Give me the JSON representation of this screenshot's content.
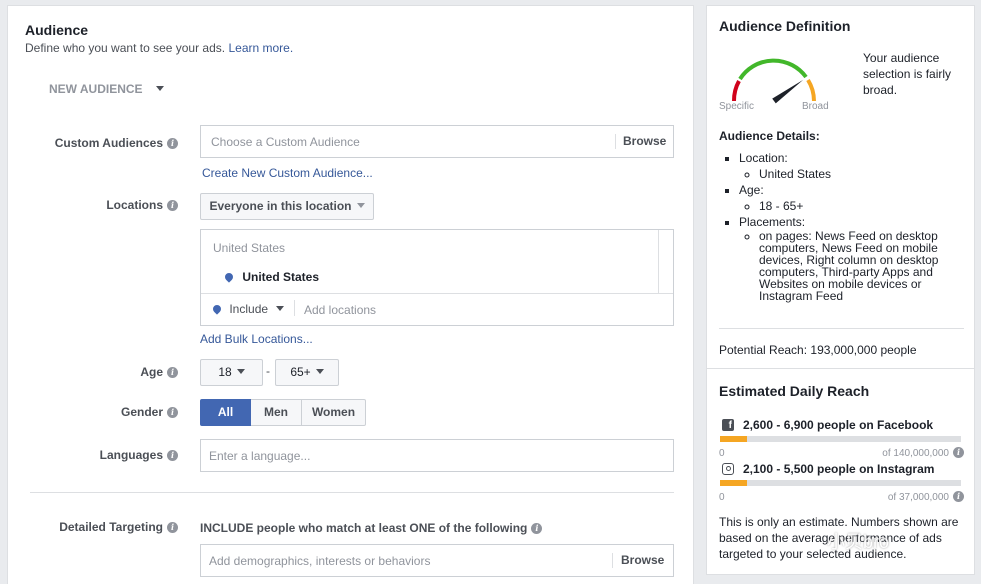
{
  "audience": {
    "title": "Audience",
    "subtitle": "Define who you want to see your ads.",
    "learn_more": "Learn more.",
    "new_audience": "NEW AUDIENCE"
  },
  "custom_audiences": {
    "label": "Custom Audiences",
    "placeholder": "Choose a Custom Audience",
    "browse": "Browse",
    "create_link": "Create New Custom Audience..."
  },
  "locations": {
    "label": "Locations",
    "dropdown": "Everyone in this location",
    "group_header": "United States",
    "selected": "United States",
    "include": "Include",
    "add_placeholder": "Add locations",
    "bulk_link": "Add Bulk Locations..."
  },
  "age": {
    "label": "Age",
    "min": "18",
    "dash": "-",
    "max": "65+"
  },
  "gender": {
    "label": "Gender",
    "options": [
      "All",
      "Men",
      "Women"
    ],
    "selected": "All"
  },
  "languages": {
    "label": "Languages",
    "placeholder": "Enter a language..."
  },
  "detailed": {
    "label": "Detailed Targeting",
    "include_text": "INCLUDE people who match at least ONE of the following",
    "placeholder": "Add demographics, interests or behaviors",
    "browse": "Browse"
  },
  "definition": {
    "title": "Audience Definition",
    "gauge_specific": "Specific",
    "gauge_broad": "Broad",
    "gauge_level": 0.8,
    "status_text": "Your audience selection is fairly broad.",
    "details_title": "Audience Details:",
    "location_label": "Location:",
    "location_value": "United States",
    "age_label": "Age:",
    "age_value": "18 - 65+",
    "placements_label": "Placements:",
    "placements_value": "on pages: News Feed on desktop computers, News Feed on mobile devices, Right column on desktop computers, Third-party Apps and Websites on mobile devices or Instagram Feed",
    "potential_reach": "Potential Reach: 193,000,000 people"
  },
  "daily_reach": {
    "title": "Estimated Daily Reach",
    "facebook": {
      "text": "2,600 - 6,900 people on Facebook",
      "min": "0",
      "max": "of 140,000,000",
      "fill": 0.11,
      "icon": "facebook-icon"
    },
    "instagram": {
      "text": "2,100 - 5,500 people on Instagram",
      "min": "0",
      "max": "of 37,000,000",
      "fill": 0.11,
      "icon": "instagram-icon"
    },
    "note": "This is only an estimate. Numbers shown are based on the average performance of ads targeted to your selected audience."
  },
  "watermark": "小贝bro",
  "colors": {
    "link": "#365899",
    "primary": "#4267b2",
    "accent": "#f5a623"
  }
}
